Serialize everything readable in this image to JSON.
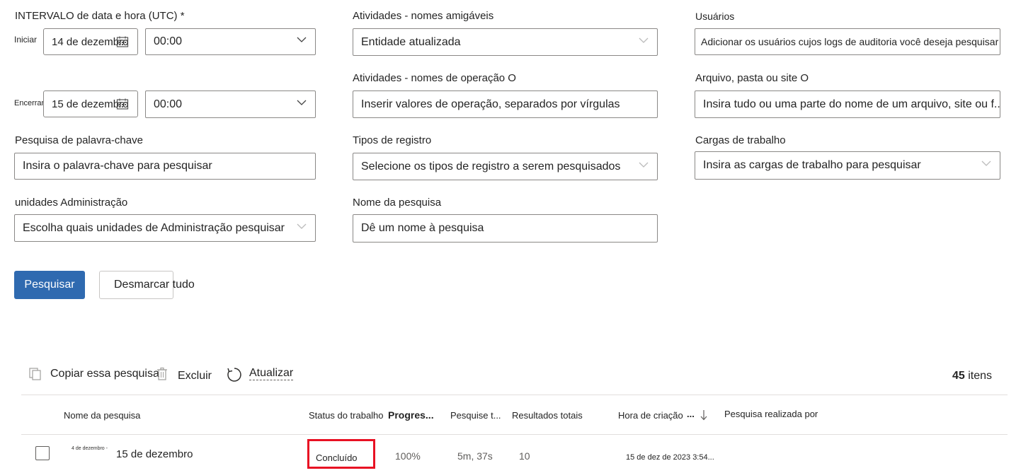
{
  "form": {
    "date_range_label": "INTERVALO de data e hora (UTC) *",
    "start_label": "Iniciar",
    "start_date": "14 de dezembro",
    "start_time": "00:00",
    "end_label": "Encerrar",
    "end_date": "15 de dezembro",
    "end_time": "00:00",
    "keyword_label": "Pesquisa de palavra-chave",
    "keyword_placeholder": "Insira o palavra-chave para pesquisar",
    "admin_units_label": "unidades Administração",
    "admin_units_placeholder": "Escolha quais unidades de Administração pesquisar",
    "activities_friendly_label": "Atividades - nomes amigáveis",
    "activities_friendly_value": "Entidade atualizada",
    "activities_operation_label": "Atividades - nomes de operação O",
    "activities_operation_placeholder": "Inserir valores de operação, separados por vírgulas",
    "record_types_label": "Tipos de registro",
    "record_types_placeholder": "Selecione os tipos de registro a serem pesquisados",
    "search_name_label": "Nome da pesquisa",
    "search_name_placeholder": "Dê um nome à pesquisa",
    "users_label": "Usuários",
    "users_placeholder": "Adicionar os usuários cujos logs de auditoria você deseja pesquisar",
    "file_label": "Arquivo, pasta ou site O",
    "file_placeholder": "Insira tudo ou uma parte do nome de um arquivo, site ou f...",
    "workloads_label": "Cargas de trabalho",
    "workloads_placeholder": "Insira as cargas de trabalho para pesquisar"
  },
  "actions": {
    "search_button": "Pesquisar",
    "clear_button": "Desmarcar tudo"
  },
  "toolbar": {
    "copy_label": "Copiar essa pesquisa",
    "delete_label": "Excluir",
    "refresh_label": "Atualizar",
    "count_number": "45",
    "count_suffix": "itens"
  },
  "table": {
    "headers": {
      "name": "Nome da pesquisa",
      "status": "Status do trabalho",
      "progress": "Progres...",
      "search_time": "Pesquise t...",
      "total_results": "Resultados totais",
      "created": "Hora de criação",
      "created_more": "...",
      "performed_by": "Pesquisa realizada por"
    },
    "rows": [
      {
        "name_prefix": "4 de dezembro -",
        "name": "15 de dezembro",
        "status": "Concluído",
        "progress": "100%",
        "search_time": "5m, 37s",
        "total_results": "10",
        "created": "15 de dez de 2023 3:54...",
        "performed_by": ""
      }
    ]
  },
  "colors": {
    "primary": "#2f6ab0",
    "highlight_border": "#e81123"
  }
}
